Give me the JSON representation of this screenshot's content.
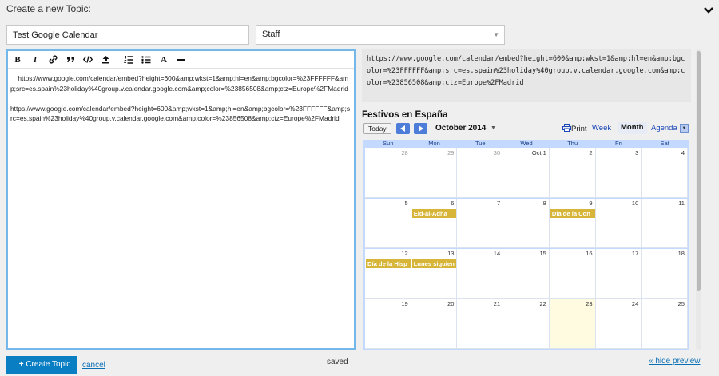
{
  "header": {
    "title": "Create a new Topic:"
  },
  "form": {
    "title_value": "Test Google Calendar",
    "category_value": "Staff"
  },
  "toolbar": {
    "items": [
      "bold-icon",
      "italic-icon",
      "link-icon",
      "quote-icon",
      "code-icon",
      "upload-icon",
      "numbered-list-icon",
      "bullet-list-icon",
      "heading-icon",
      "horizontal-rule-icon"
    ],
    "bold_label": "B",
    "italic_label": "I",
    "heading_label": "A"
  },
  "editor": {
    "content": "    https://www.google.com/calendar/embed?height=600&amp;wkst=1&amp;hl=en&amp;bgcolor=%23FFFFFF&amp;src=es.spain%23holiday%40group.v.calendar.google.com&amp;color=%23856508&amp;ctz=Europe%2FMadrid\n\nhttps://www.google.com/calendar/embed?height=600&amp;wkst=1&amp;hl=en&amp;bgcolor=%23FFFFFF&amp;src=es.spain%23holiday%40group.v.calendar.google.com&amp;color=%23856508&amp;ctz=Europe%2FMadrid"
  },
  "preview": {
    "code_text": "https://www.google.com/calendar/embed?height=600&amp;wkst=1&amp;hl=en&amp;bgcolor=%23FFFFFF&amp;src=es.spain%23holiday%40group.v.calendar.google.com&amp;color=%23856508&amp;ctz=Europe%2FMadrid",
    "calendar": {
      "title": "Festivos en España",
      "today_label": "Today",
      "month_label": "October 2014",
      "print_label": "Print",
      "views": {
        "week": "Week",
        "month": "Month",
        "agenda": "Agenda"
      },
      "weekdays": [
        "Sun",
        "Mon",
        "Tue",
        "Wed",
        "Thu",
        "Fri",
        "Sat"
      ],
      "weeks": [
        [
          "28",
          "29",
          "30",
          "Oct 1",
          "2",
          "3",
          "4"
        ],
        [
          "5",
          "6",
          "7",
          "8",
          "9",
          "10",
          "11"
        ],
        [
          "12",
          "13",
          "14",
          "15",
          "16",
          "17",
          "18"
        ],
        [
          "19",
          "20",
          "21",
          "22",
          "23",
          "24",
          "25"
        ]
      ],
      "events": [
        {
          "label": "Eid-al-Adha",
          "week": 1,
          "day": 1
        },
        {
          "label": "Día de la Con",
          "week": 1,
          "day": 4
        },
        {
          "label": "Día de la Hisp",
          "week": 2,
          "day": 0
        },
        {
          "label": "Lunes siguien",
          "week": 2,
          "day": 1
        }
      ],
      "event_color": "#d6b538",
      "today_week": 3,
      "today_day": 4
    }
  },
  "footer": {
    "create_label": "Create Topic",
    "cancel_label": "cancel",
    "status_text": "saved",
    "hide_preview_label": "« hide preview"
  },
  "colors": {
    "accent": "#0a7ec3",
    "editor_border": "#75b7e9",
    "calendar_header": "#c3d9ff"
  }
}
